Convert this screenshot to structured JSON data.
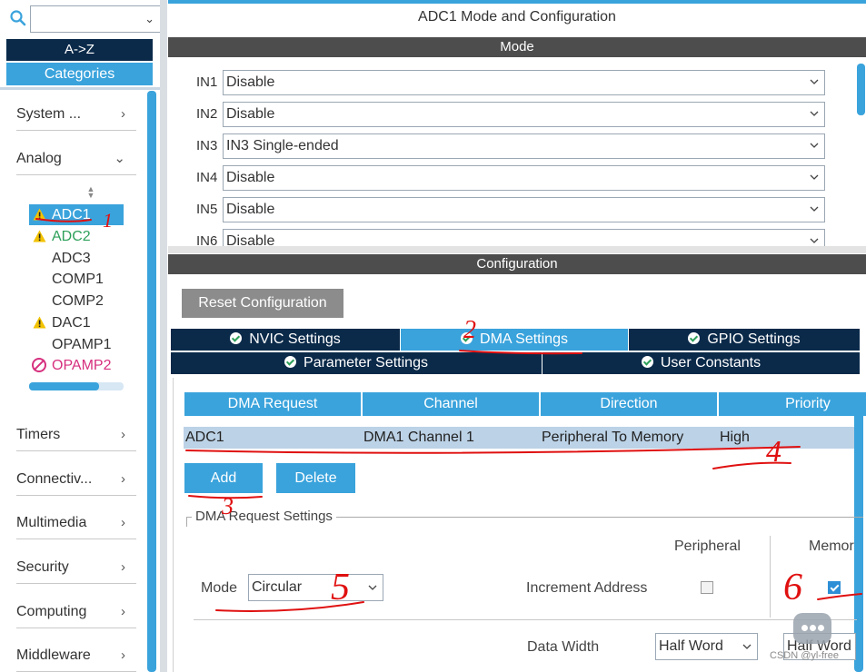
{
  "left_panel": {
    "search_value": "",
    "az_label": "A->Z",
    "categories_label": "Categories",
    "categories": [
      {
        "label": "System ...",
        "arrow": "›"
      },
      {
        "label": "Analog",
        "arrow": "⌄"
      },
      {
        "label": "Timers",
        "arrow": "›"
      },
      {
        "label": "Connectiv...",
        "arrow": "›"
      },
      {
        "label": "Multimedia",
        "arrow": "›"
      },
      {
        "label": "Security",
        "arrow": "›"
      },
      {
        "label": "Computing",
        "arrow": "›"
      },
      {
        "label": "Middleware",
        "arrow": "›"
      }
    ],
    "analog_items": [
      {
        "label": "ADC1",
        "status": "warning",
        "selected": true
      },
      {
        "label": "ADC2",
        "status": "warning",
        "color": "#2ea05a"
      },
      {
        "label": "ADC3",
        "status": "none"
      },
      {
        "label": "COMP1",
        "status": "none"
      },
      {
        "label": "COMP2",
        "status": "none"
      },
      {
        "label": "DAC1",
        "status": "warning"
      },
      {
        "label": "OPAMP1",
        "status": "none"
      },
      {
        "label": "OPAMP2",
        "status": "forbidden",
        "color": "#d6307e"
      }
    ],
    "list_scroll_fraction": 0.74
  },
  "main": {
    "title": "ADC1 Mode and Configuration",
    "mode_header": "Mode",
    "mode_rows": [
      {
        "label": "IN1",
        "value": "Disable"
      },
      {
        "label": "IN2",
        "value": "Disable"
      },
      {
        "label": "IN3",
        "value": "IN3 Single-ended"
      },
      {
        "label": "IN4",
        "value": "Disable"
      },
      {
        "label": "IN5",
        "value": "Disable"
      },
      {
        "label": "IN6",
        "value": "Disable"
      }
    ],
    "config_header": "Configuration",
    "reset_label": "Reset Configuration",
    "tabs_row1": [
      "NVIC Settings",
      "DMA Settings",
      "GPIO Settings"
    ],
    "tabs_row2": [
      "Parameter Settings",
      "User Constants"
    ],
    "active_tab": "DMA Settings",
    "dma_table": {
      "headers": [
        "DMA Request",
        "Channel",
        "Direction",
        "Priority"
      ],
      "rows": [
        [
          "ADC1",
          "DMA1 Channel 1",
          "Peripheral To Memory",
          "High"
        ]
      ]
    },
    "add_label": "Add",
    "delete_label": "Delete",
    "request_settings": {
      "group_title": "DMA Request Settings",
      "peripheral_col": "Peripheral",
      "memory_col": "Memor",
      "mode_label": "Mode",
      "mode_value": "Circular",
      "increment_label": "Increment Address",
      "peripheral_increment": false,
      "memory_increment": true,
      "data_width_label": "Data Width",
      "peripheral_width": "Half Word",
      "memory_width": "Half Word"
    }
  },
  "annotations": [
    "1",
    "2",
    "3",
    "4",
    "5",
    "6"
  ],
  "watermark": "CSDN @yl-free",
  "colors": {
    "accent": "#3aa3dc",
    "dark_navy": "#0b2a4a",
    "header_gray": "#4d4d4d",
    "annotation_red": "#e01010",
    "warning_yellow": "#f2c200"
  }
}
